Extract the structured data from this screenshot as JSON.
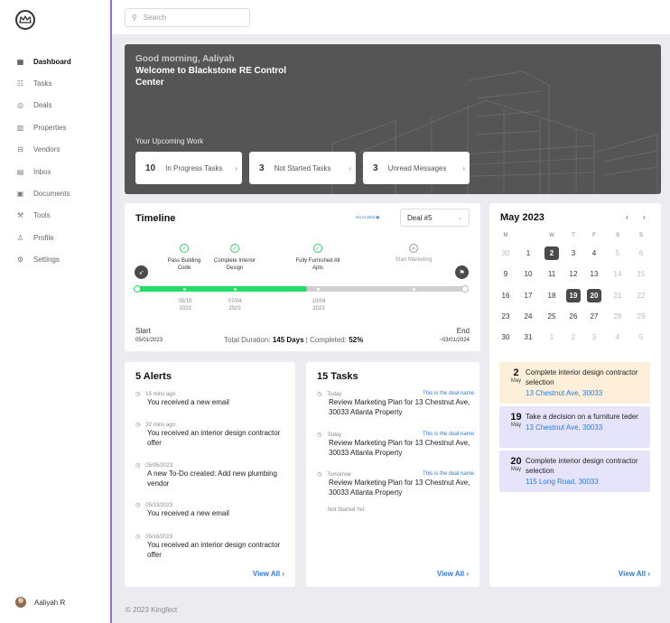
{
  "nav": {
    "items": [
      {
        "label": "Dashboard",
        "icon": "grid-icon",
        "glyph": "▦",
        "active": true
      },
      {
        "label": "Tasks",
        "icon": "tasks-icon",
        "glyph": "☷"
      },
      {
        "label": "Deals",
        "icon": "handshake-icon",
        "glyph": "◎"
      },
      {
        "label": "Properties",
        "icon": "building-icon",
        "glyph": "▥"
      },
      {
        "label": "Vendors",
        "icon": "book-icon",
        "glyph": "⊟"
      },
      {
        "label": "Inbox",
        "icon": "inbox-icon",
        "glyph": "▤"
      },
      {
        "label": "Documents",
        "icon": "documents-icon",
        "glyph": "▣"
      },
      {
        "label": "Tools",
        "icon": "tools-icon",
        "glyph": "⚒"
      },
      {
        "label": "Profile",
        "icon": "profile-icon",
        "glyph": "♙"
      },
      {
        "label": "Settings",
        "icon": "settings-icon",
        "glyph": "⚙"
      }
    ],
    "user": "Aaliyah R"
  },
  "search": {
    "placeholder": "Search"
  },
  "hero": {
    "greeting": "Good morning, Aaliyah",
    "title": "Welcome to Blackstone RE Control Center",
    "subtitle": "Your Upcoming Work",
    "cards": [
      {
        "count": "10",
        "label": "In Progress Tasks"
      },
      {
        "count": "3",
        "label": "Not Started Tasks"
      },
      {
        "count": "3",
        "label": "Unread Messages"
      }
    ]
  },
  "timeline": {
    "title": "Timeline",
    "go_to_deal": "Go to deal",
    "deal_select": "Deal #5",
    "progress": 0.52,
    "milestones": [
      {
        "label": "Pass Building Code",
        "date": "05/18 2023",
        "done": true
      },
      {
        "label": "Complete Interior Design",
        "date": "07/04 2023",
        "done": true
      },
      {
        "label": "Fully Furnished All Apts",
        "date": "10/04 2023",
        "done": true
      },
      {
        "label": "Start Marketing",
        "date": "",
        "done": false
      }
    ],
    "start_label": "Start",
    "start_date": "05/01/2023",
    "end_label": "End",
    "end_date": "~03/01/2024",
    "duration_label": "Total Duration:",
    "duration_value": "145 Days",
    "completed_label": "| Completed:",
    "completed_value": "52%"
  },
  "calendar": {
    "month": "May 2023",
    "weekdays": [
      "M",
      "",
      "W",
      "T",
      "F",
      "S",
      "S"
    ],
    "weeks": [
      [
        "30",
        "1",
        "2",
        "3",
        "4",
        "5",
        "6"
      ],
      [
        "9",
        "10",
        "11",
        "12",
        "13",
        "14",
        "15"
      ],
      [
        "16",
        "17",
        "18",
        "19",
        "20",
        "21",
        "22"
      ],
      [
        "23",
        "24",
        "25",
        "26",
        "27",
        "28",
        "29"
      ],
      [
        "30",
        "31",
        "1",
        "2",
        "3",
        "4",
        "5"
      ]
    ],
    "events": [
      {
        "day": "2",
        "month": "May",
        "title": "Complete interior design contractor selection",
        "address": "13 Chestnut Ave, 30033",
        "color": "#fdefd9"
      },
      {
        "day": "19",
        "month": "May",
        "title": "Take a decision on a furniture teder",
        "address": "13 Chestnut Ave, 30033",
        "color": "#e6e4fb"
      },
      {
        "day": "20",
        "month": "May",
        "title": "Complete interior design contractor selection",
        "address": "115 Long Road, 30033",
        "color": "#e6e4fb"
      }
    ],
    "view_all": "View All  ›"
  },
  "alerts": {
    "title": "5 Alerts",
    "items": [
      {
        "time": "15 mins ago",
        "text": "You received a new email"
      },
      {
        "time": "32 mins ago",
        "text": "You received an interior design contractor offer"
      },
      {
        "time": "05/05/2023",
        "text": "A new To-Do created: Add new plumbing vendor"
      },
      {
        "time": "05/13/2023",
        "text": "You received a new email"
      },
      {
        "time": "05/16/2023",
        "text": "You received an interior design contractor offer"
      }
    ],
    "view_all": "View All  ›"
  },
  "tasks": {
    "title": "15 Tasks",
    "items": [
      {
        "time": "Today",
        "deal": "This is  the deal name",
        "text": "Review Marketing Plan for 13 Chestnut Ave, 30033 Atlanta Property"
      },
      {
        "time": "Today",
        "deal": "This is  the deal name",
        "text": "Review Marketing Plan for 13 Chestnut Ave, 30033 Atlanta Property"
      },
      {
        "time": "Tomorrow",
        "deal": "This is  the deal name",
        "text": "Review Marketing Plan for 13 Chestnut Ave, 30033 Atlanta Property"
      }
    ],
    "status": "Not Started Yet",
    "view_all": "View All  ›"
  },
  "footer": "© 2023 Kingfect"
}
